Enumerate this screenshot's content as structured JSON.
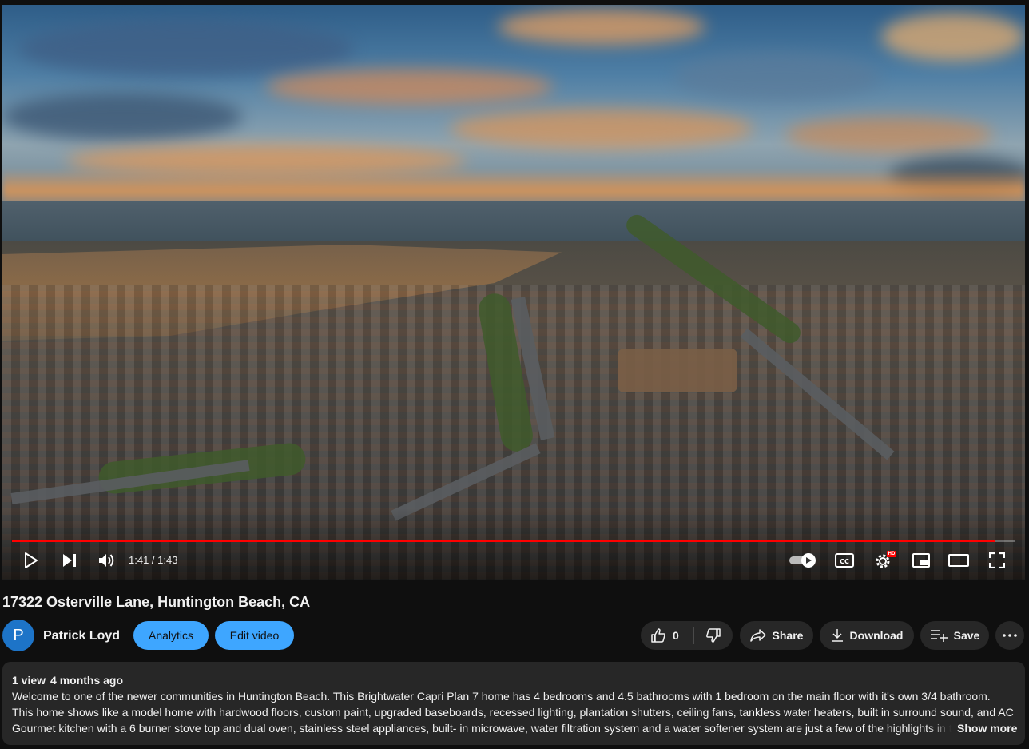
{
  "player": {
    "time_display": "1:41 / 1:43",
    "progress_fraction": 0.98,
    "quality_badge": "HD",
    "accent_color": "#ff0000",
    "icons": [
      "play-icon",
      "next-icon",
      "volume-icon",
      "autoplay-toggle-icon",
      "captions-icon",
      "settings-icon",
      "miniplayer-icon",
      "theater-mode-icon",
      "fullscreen-icon"
    ]
  },
  "video": {
    "title": "17322 Osterville Lane, Huntington Beach, CA"
  },
  "channel": {
    "avatar_letter": "P",
    "name": "Patrick Loyd",
    "avatar_color": "#1d74c8"
  },
  "actions": {
    "analytics_label": "Analytics",
    "edit_label": "Edit video",
    "like_count": "0",
    "share_label": "Share",
    "download_label": "Download",
    "save_label": "Save",
    "button_color": "#3ea6ff"
  },
  "description": {
    "views": "1 view",
    "age": "4 months ago",
    "lines": [
      "Welcome to one of the newer communities in Huntington Beach. This Brightwater Capri Plan 7 home has 4 bedrooms and 4.5 bathrooms with 1 bedroom on the main floor with it's own 3/4 bathroom.",
      "This home shows like a model home with hardwood floors, custom paint, upgraded baseboards, recessed lighting, plantation shutters, ceiling fans, tankless water heaters, built in surround sound, and AC.",
      "Gourmet kitchen with a 6 burner stove top and dual oven, stainless steel appliances, built- in microwave, water filtration system and a water softener system are just a few of the highlights in t"
    ],
    "show_more_label": "Show more"
  }
}
